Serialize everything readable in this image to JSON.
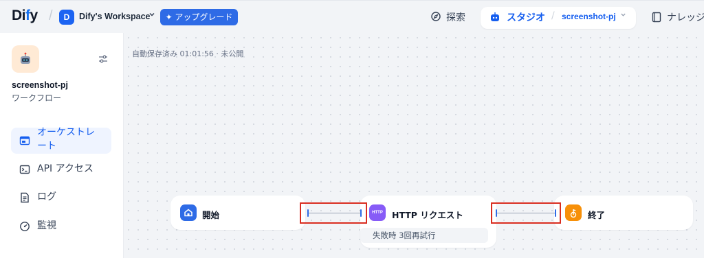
{
  "header": {
    "logo_main": "Di",
    "logo_accent": "f",
    "logo_end": "y",
    "slash": "/",
    "workspace_initial": "D",
    "workspace_name": "Dify's Workspace",
    "upgrade_label": "✦ アップグレード",
    "explore_label": "探索",
    "studio_label": "スタジオ",
    "studio_app": "screenshot-pj",
    "knowledge_label": "ナレッジ"
  },
  "sidebar": {
    "app_name": "screenshot-pj",
    "app_type": "ワークフロー",
    "items": [
      {
        "label_line1": "オーケストレ",
        "label_line2": "ート",
        "active": true
      },
      {
        "label": "API アクセス"
      },
      {
        "label": "ログ"
      },
      {
        "label": "監視"
      }
    ]
  },
  "canvas": {
    "autosave": "自動保存済み 01:01:56 · 未公開",
    "nodes": {
      "start": {
        "title": "開始"
      },
      "http": {
        "title": "HTTP リクエスト",
        "badge": "HTTP",
        "subtitle": "失敗時 3回再試行"
      },
      "end": {
        "title": "終了"
      }
    }
  },
  "colors": {
    "accent": "#155eef",
    "upgrade": "#2e6be6",
    "start_node": "#2e6be6",
    "http_node": "#875bf7",
    "end_node": "#f79009",
    "highlight": "#d92d20"
  }
}
